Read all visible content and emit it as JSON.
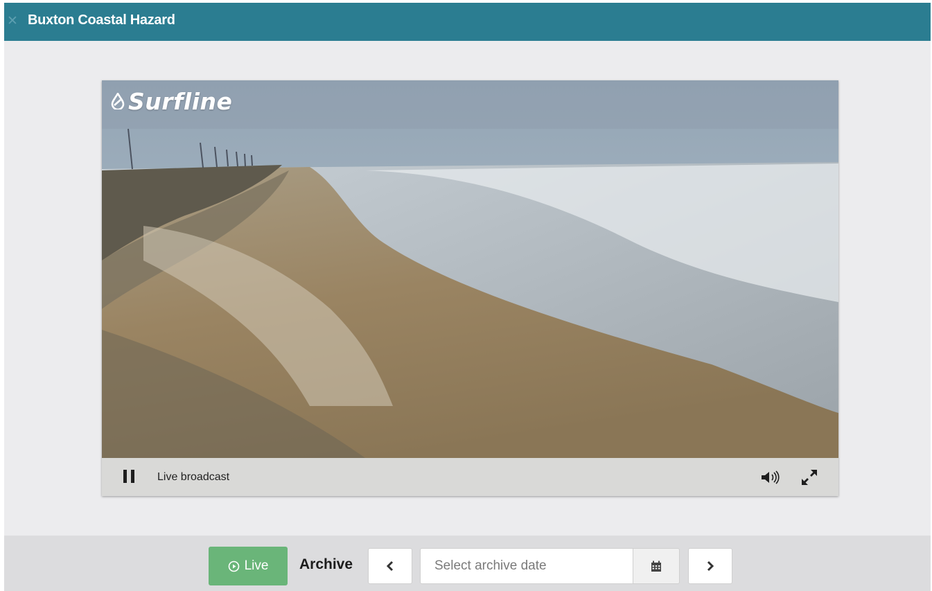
{
  "window": {
    "title": "Buxton Coastal Hazard",
    "close_icon": "close-icon"
  },
  "player": {
    "logo_text": "Surfline",
    "status": "Live broadcast",
    "controls": {
      "pause_icon": "pause-icon",
      "volume_icon": "volume-icon",
      "fullscreen_icon": "fullscreen-icon"
    }
  },
  "toolbar": {
    "live_label": "Live",
    "archive_label": "Archive",
    "date_placeholder": "Select archive date",
    "calendar_icon": "calendar-icon",
    "prev_icon": "chevron-left-icon",
    "next_icon": "chevron-right-icon"
  },
  "colors": {
    "header": "#2b7d91",
    "live_button": "#6ab579",
    "panel": "#ececee"
  }
}
